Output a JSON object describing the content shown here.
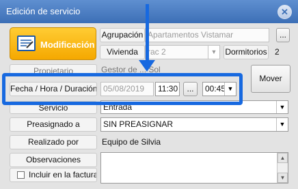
{
  "window": {
    "title": "Edición de servicio",
    "close_glyph": "✕"
  },
  "action": {
    "modificacion_label": "Modificación",
    "icon": "edit-form-icon"
  },
  "agrupacion": {
    "label": "Agrupación",
    "value": "Apartamentos Vistamar",
    "button_label": "..."
  },
  "vivienda": {
    "label": "Vivienda",
    "value": "rac 2",
    "dormitorios_label": "Dormitorios",
    "dormitorios_value": "2"
  },
  "propietario": {
    "label": "Propietario",
    "value": "Gestor de ...      Sol"
  },
  "fecha": {
    "label": "Fecha / Hora / Duración",
    "date": "05/08/2019",
    "time": "11:30",
    "picker_label": "...",
    "duration": "00:45"
  },
  "mover_button": "Mover",
  "servicio": {
    "label": "Servicio",
    "value": "Entrada"
  },
  "preasignado": {
    "label": "Preasignado a",
    "value": "SIN PREASIGNAR"
  },
  "realizado": {
    "label": "Realizado por",
    "value": "Equipo de Silvia"
  },
  "observaciones": {
    "label": "Observaciones",
    "value": ""
  },
  "factura": {
    "label": "Incluir en la factura",
    "checked": false
  },
  "dropdown_glyph": "▼",
  "scroll_up": "▲",
  "scroll_down": "▼",
  "colors": {
    "titlebar": "#4a7cc2",
    "action_button": "#f7b500",
    "highlight": "#1769e0"
  }
}
